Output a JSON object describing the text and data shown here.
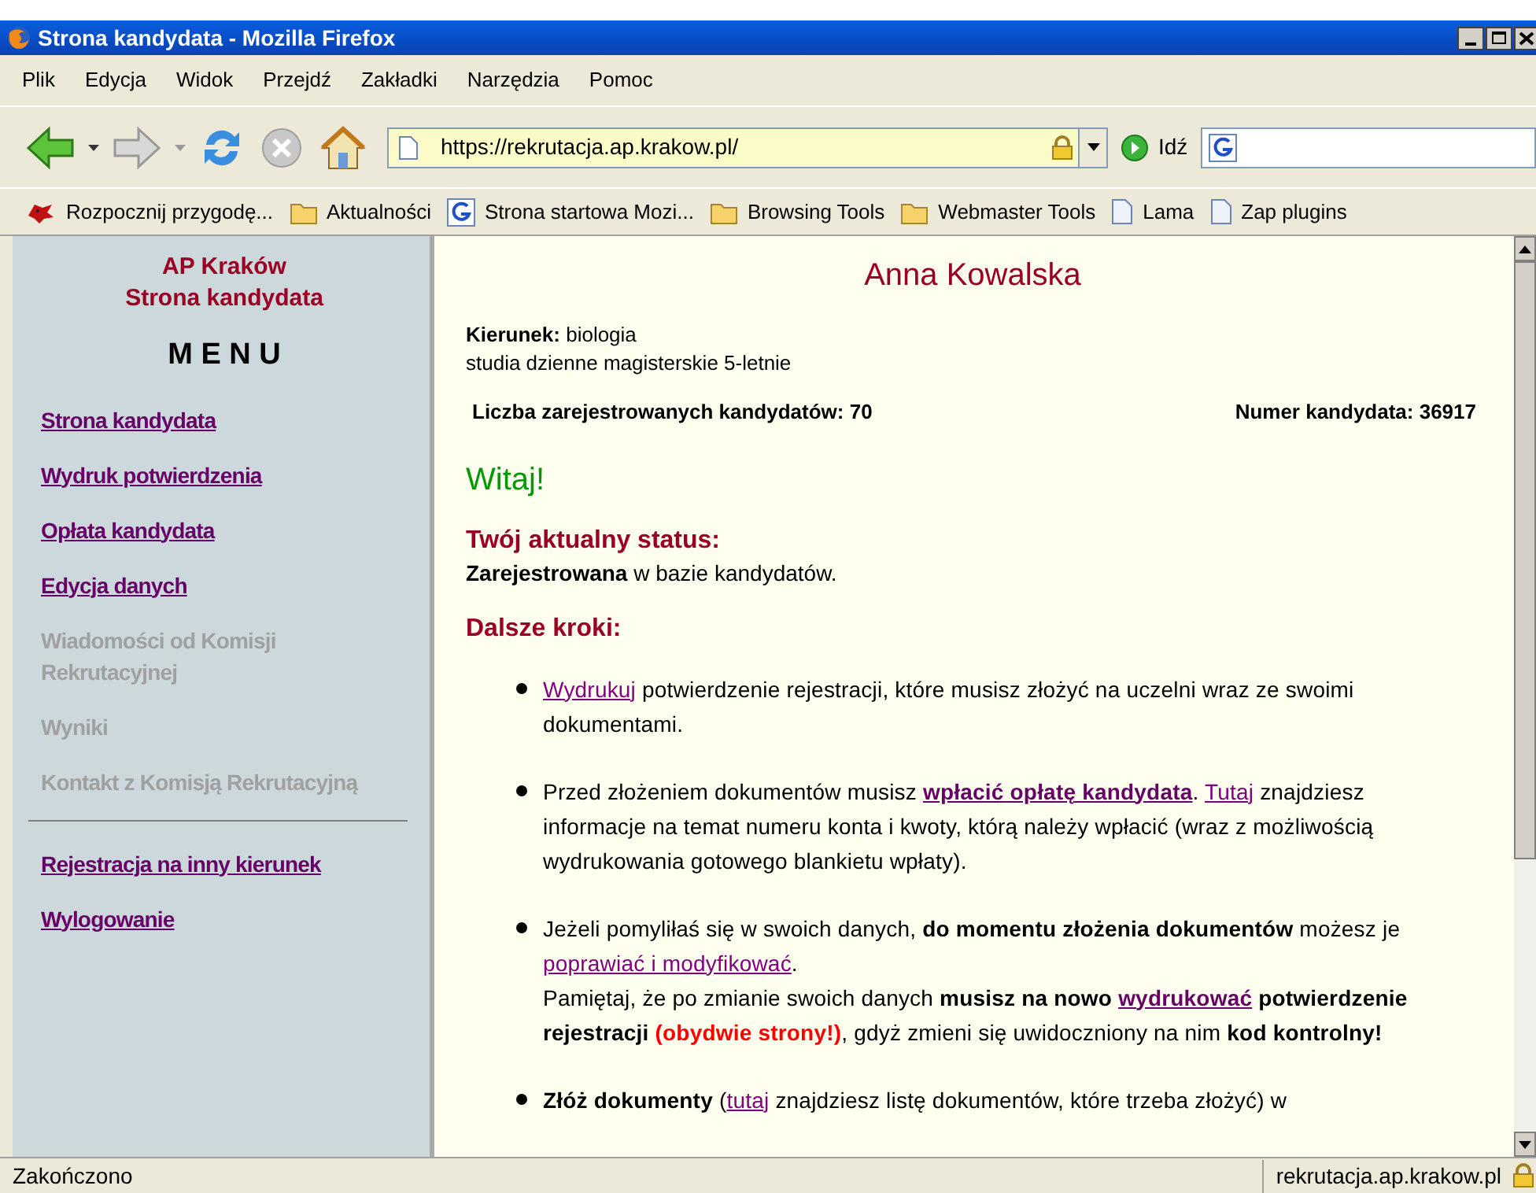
{
  "window": {
    "title": "Strona kandydata - Mozilla Firefox"
  },
  "menu_bar": [
    {
      "label": "Plik"
    },
    {
      "label": "Edycja"
    },
    {
      "label": "Widok"
    },
    {
      "label": "Przejdź"
    },
    {
      "label": "Zakładki"
    },
    {
      "label": "Narzędzia"
    },
    {
      "label": "Pomoc"
    }
  ],
  "toolbar": {
    "address": "https://rekrutacja.ap.krakow.pl/",
    "go_label": "Idź"
  },
  "bookmarks": [
    {
      "label": "Rozpocznij przygodę...",
      "kind": "custom"
    },
    {
      "label": "Aktualności",
      "kind": "folder"
    },
    {
      "label": "Strona startowa Mozi...",
      "kind": "google"
    },
    {
      "label": "Browsing Tools",
      "kind": "folder"
    },
    {
      "label": "Webmaster Tools",
      "kind": "folder"
    },
    {
      "label": "Lama",
      "kind": "page"
    },
    {
      "label": "Zap plugins",
      "kind": "page"
    }
  ],
  "sidebar": {
    "title_lines": [
      "AP Kraków",
      "Strona kandydata"
    ],
    "menu_heading": "M E N U",
    "items": [
      {
        "label": "Strona kandydata",
        "disabled": false
      },
      {
        "label": "Wydruk potwierdzenia",
        "disabled": false
      },
      {
        "label": "Opłata kandydata",
        "disabled": false
      },
      {
        "label": "Edycja danych",
        "disabled": false
      },
      {
        "label": "Wiadomości od Komisji Rekrutacyjnej",
        "disabled": true
      },
      {
        "label": "Wyniki",
        "disabled": true
      },
      {
        "label": "Kontakt z Komisją Rekrutacyjną",
        "disabled": true
      }
    ],
    "bottom_items": [
      {
        "label": "Rejestracja na inny kierunek",
        "disabled": false
      },
      {
        "label": "Wylogowanie",
        "disabled": false
      }
    ]
  },
  "page": {
    "name": "Anna Kowalska",
    "field_label": "Kierunek:",
    "field_value": "biologia",
    "study_mode": "studia dzienne magisterskie 5-letnie",
    "count_text": "Liczba zarejestrowanych kandydatów: 70",
    "number_text": "Numer kandydata: 36917",
    "greeting": "Witaj!",
    "status_heading": "Twój aktualny status:",
    "status_text": "**Zarejestrowana** w bazie kandydatów.",
    "steps_heading": "Dalsze kroki:",
    "steps": [
      {
        "lines": [
          [
            {
              "kind": "link",
              "text": "Wydrukuj"
            },
            {
              "kind": "text",
              "text": " potwierdzenie rejestracji, które musisz złożyć na uczelni wraz ze swoimi dokumentami."
            }
          ]
        ]
      },
      {
        "lines": [
          [
            {
              "kind": "text",
              "text": "Przed złożeniem dokumentów musisz "
            },
            {
              "kind": "strong_link",
              "text": "wpłacić opłatę kandydata"
            },
            {
              "kind": "text",
              "text": ". "
            },
            {
              "kind": "link",
              "text": "Tutaj"
            },
            {
              "kind": "text",
              "text": " znajdziesz informacje na temat numeru konta i kwoty, którą należy wpłacić (wraz z możliwością wydrukowania gotowego blankietu wpłaty)."
            }
          ]
        ]
      },
      {
        "lines": [
          [
            {
              "kind": "text",
              "text": "Jeżeli pomyliłaś się w swoich danych, "
            },
            {
              "kind": "bold",
              "text": "do momentu złożenia dokumentów"
            },
            {
              "kind": "text",
              "text": " możesz je "
            },
            {
              "kind": "link",
              "text": "poprawiać i modyfikować"
            },
            {
              "kind": "text",
              "text": "."
            }
          ],
          [
            {
              "kind": "text",
              "text": "Pamiętaj, że po zmianie swoich danych "
            },
            {
              "kind": "bold",
              "text": "musisz na nowo "
            },
            {
              "kind": "strong_link",
              "text": "wydrukować"
            },
            {
              "kind": "bold",
              "text": " potwierdzenie rejestracji "
            },
            {
              "kind": "alert",
              "text": "(obydwie strony!)"
            },
            {
              "kind": "text",
              "text": ", gdyż zmieni się uwidoczniony na nim "
            },
            {
              "kind": "bold",
              "text": "kod kontrolny!"
            }
          ]
        ]
      },
      {
        "lines": [
          [
            {
              "kind": "bold",
              "text": "Złóż dokumenty"
            },
            {
              "kind": "text",
              "text": " ("
            },
            {
              "kind": "link",
              "text": "tutaj"
            },
            {
              "kind": "text",
              "text": " znajdziesz listę dokumentów, które trzeba złożyć) w"
            }
          ]
        ]
      }
    ]
  },
  "status_bar": {
    "text": "Zakończono",
    "host": "rekrutacja.ap.krakow.pl"
  }
}
